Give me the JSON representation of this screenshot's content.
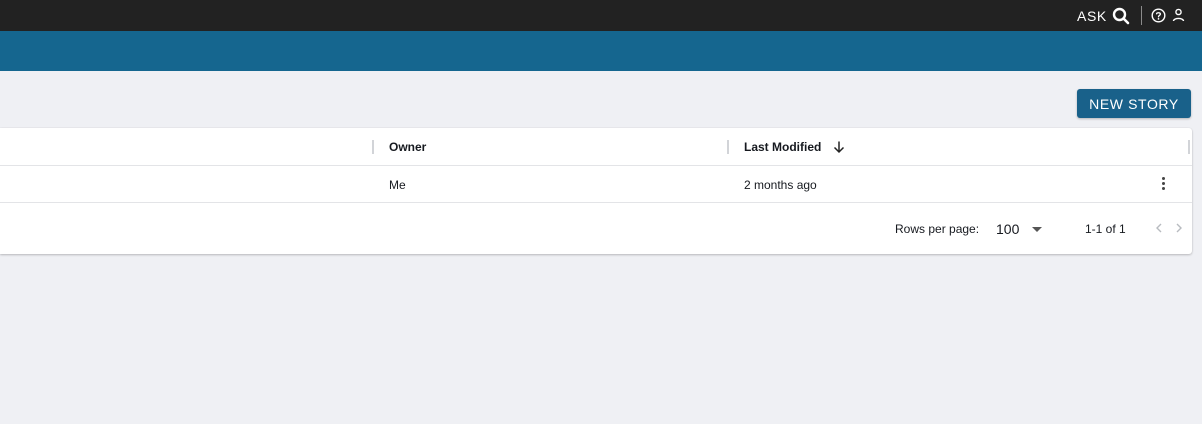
{
  "topbar": {
    "ask_label": "ASK",
    "icons": [
      "search-icon",
      "help-icon",
      "user-icon"
    ]
  },
  "toolbar": {
    "new_story_label": "NEW STORY"
  },
  "table": {
    "columns": [
      "Owner",
      "Last Modified"
    ],
    "sort": {
      "column": "Last Modified",
      "direction": "descending",
      "icon": "arrow-down-icon"
    },
    "rows": [
      {
        "owner": "Me",
        "last_modified": "2 months ago",
        "menu_icon": "more-vert-icon"
      }
    ]
  },
  "pagination": {
    "rows_per_page_label": "Rows per page:",
    "rows_per_page_value": "100",
    "range_label": "1-1 of 1",
    "prev_icon": "chevron-left-icon",
    "next_icon": "chevron-right-icon"
  },
  "colors": {
    "topbar": "#222222",
    "banner": "#15668f",
    "button": "#19618a",
    "background": "#eff0f4"
  }
}
